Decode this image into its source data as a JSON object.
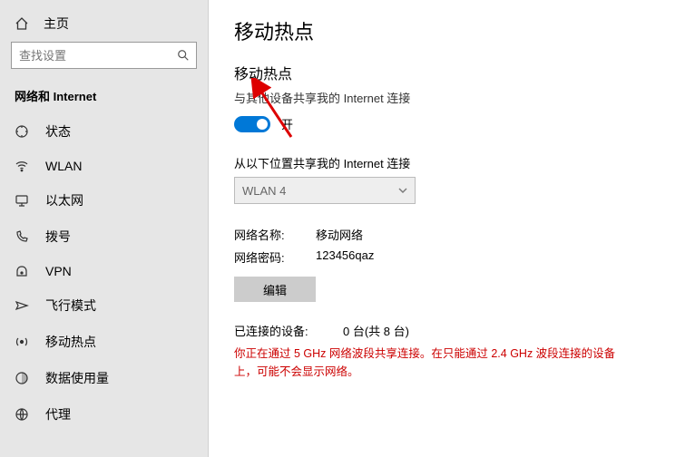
{
  "sidebar": {
    "home": "主页",
    "search_placeholder": "查找设置",
    "section": "网络和 Internet",
    "items": [
      {
        "label": "状态"
      },
      {
        "label": "WLAN"
      },
      {
        "label": "以太网"
      },
      {
        "label": "拨号"
      },
      {
        "label": "VPN"
      },
      {
        "label": "飞行模式"
      },
      {
        "label": "移动热点"
      },
      {
        "label": "数据使用量"
      },
      {
        "label": "代理"
      }
    ]
  },
  "main": {
    "title": "移动热点",
    "subtitle": "移动热点",
    "share_desc": "与其他设备共享我的 Internet 连接",
    "toggle_state": "开",
    "from_label": "从以下位置共享我的 Internet 连接",
    "from_value": "WLAN 4",
    "net_name_k": "网络名称:",
    "net_name_v": "移动网络",
    "net_pwd_k": "网络密码:",
    "net_pwd_v": "123456qaz",
    "edit": "编辑",
    "connected_k": "已连接的设备:",
    "connected_v": "0 台(共 8 台)",
    "warning": "你正在通过 5 GHz 网络波段共享连接。在只能通过 2.4 GHz 波段连接的设备上，可能不会显示网络。"
  }
}
